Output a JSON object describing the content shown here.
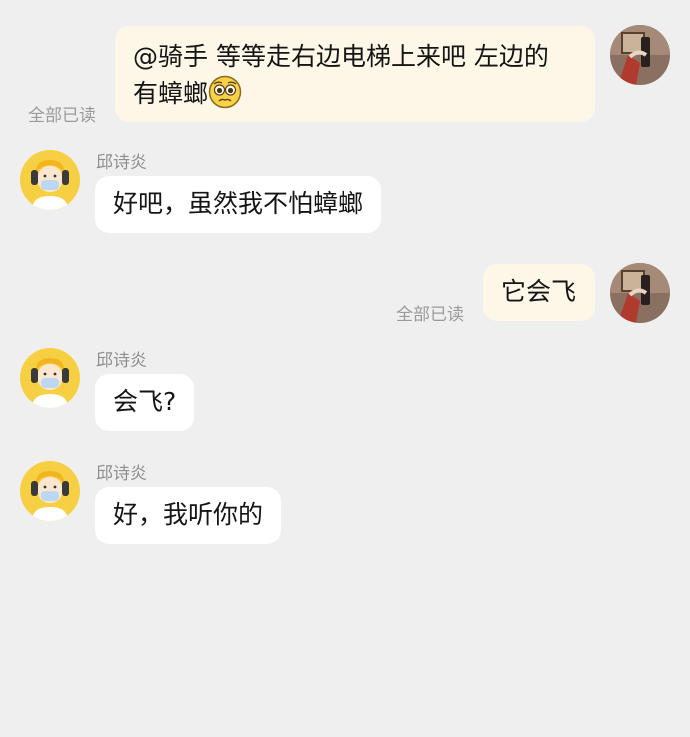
{
  "chat": {
    "messages": [
      {
        "side": "me",
        "text_line1": "@骑手 等等走右边电梯上来吧 左边的",
        "text_line2": "有蟑螂",
        "emoji": "pleading-face-emoji",
        "read_status": "全部已读"
      },
      {
        "side": "them",
        "sender": "邱诗炎",
        "text": "好吧，虽然我不怕蟑螂"
      },
      {
        "side": "me",
        "text": "它会飞",
        "read_status": "全部已读"
      },
      {
        "side": "them",
        "sender": "邱诗炎",
        "text": "会飞?"
      },
      {
        "side": "them",
        "sender": "邱诗炎",
        "text": "好，我听你的"
      }
    ]
  },
  "colors": {
    "background": "#efeff0",
    "my_bubble": "#fdf7e8",
    "their_bubble": "#ffffff",
    "meta_text": "#9a9a9a",
    "avatar_yellow": "#f7cf43"
  },
  "icons": {
    "my_avatar": "photo-avatar",
    "their_avatar": "masked-person-avatar",
    "emoji": "pleading-face-emoji"
  }
}
